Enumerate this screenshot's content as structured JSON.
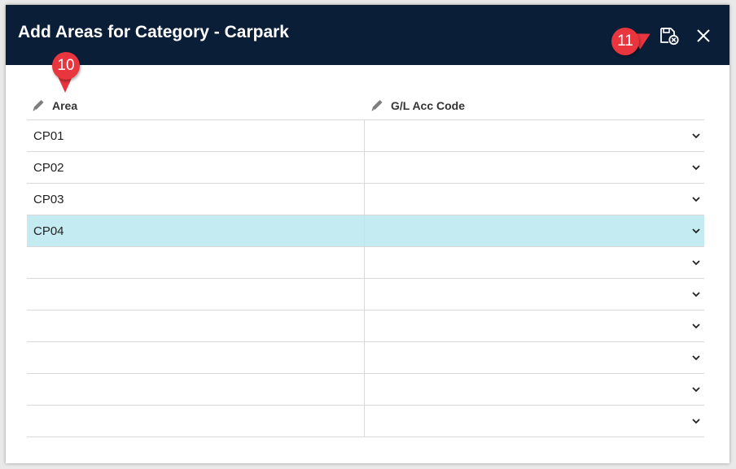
{
  "dialog": {
    "title": "Add Areas for Category - Carpark",
    "header_bg": "#0b1e38",
    "icons": {
      "save_cancel": "save-cancel-icon",
      "close": "close-icon"
    }
  },
  "callouts": [
    {
      "label": "10",
      "color": "#e8353e"
    },
    {
      "label": "11",
      "color": "#e8353e"
    }
  ],
  "columns": [
    {
      "label": "Area",
      "icon": "pencil-icon"
    },
    {
      "label": "G/L Acc Code",
      "icon": "pencil-icon"
    }
  ],
  "rows": [
    {
      "area": "CP01",
      "gl_code": "",
      "selected": false
    },
    {
      "area": "CP02",
      "gl_code": "",
      "selected": false
    },
    {
      "area": "CP03",
      "gl_code": "",
      "selected": false
    },
    {
      "area": "CP04",
      "gl_code": "",
      "selected": true
    },
    {
      "area": "",
      "gl_code": "",
      "selected": false
    },
    {
      "area": "",
      "gl_code": "",
      "selected": false
    },
    {
      "area": "",
      "gl_code": "",
      "selected": false
    },
    {
      "area": "",
      "gl_code": "",
      "selected": false
    },
    {
      "area": "",
      "gl_code": "",
      "selected": false
    },
    {
      "area": "",
      "gl_code": "",
      "selected": false
    }
  ],
  "selected_row_color": "#c4ebf2"
}
